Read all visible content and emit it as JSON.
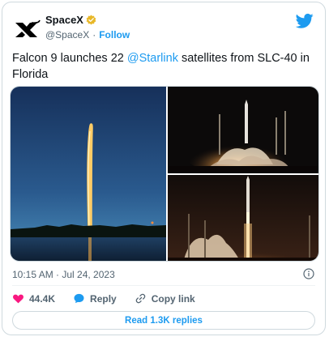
{
  "account": {
    "display_name": "SpaceX",
    "handle": "@SpaceX",
    "separator": "·",
    "follow_label": "Follow"
  },
  "tweet": {
    "text_before": "Falcon 9 launches 22 ",
    "mention": "@Starlink",
    "text_after": " satellites from SLC-40 in Florida",
    "timestamp": "10:15 AM · Jul 24, 2023"
  },
  "media": [
    {
      "icon": "rocket-launch-long-exposure-photo"
    },
    {
      "icon": "rocket-liftoff-pad-photo"
    },
    {
      "icon": "rocket-ascent-pad-photo"
    }
  ],
  "actions": {
    "likes_count": "44.4K",
    "reply_label": "Reply",
    "copy_link_label": "Copy link",
    "read_replies_label": "Read 1.3K replies"
  },
  "colors": {
    "accent": "#1d9bf0",
    "like": "#f91880",
    "verified": "#e8b829",
    "text_secondary": "#536471",
    "border": "#cfd9de"
  }
}
